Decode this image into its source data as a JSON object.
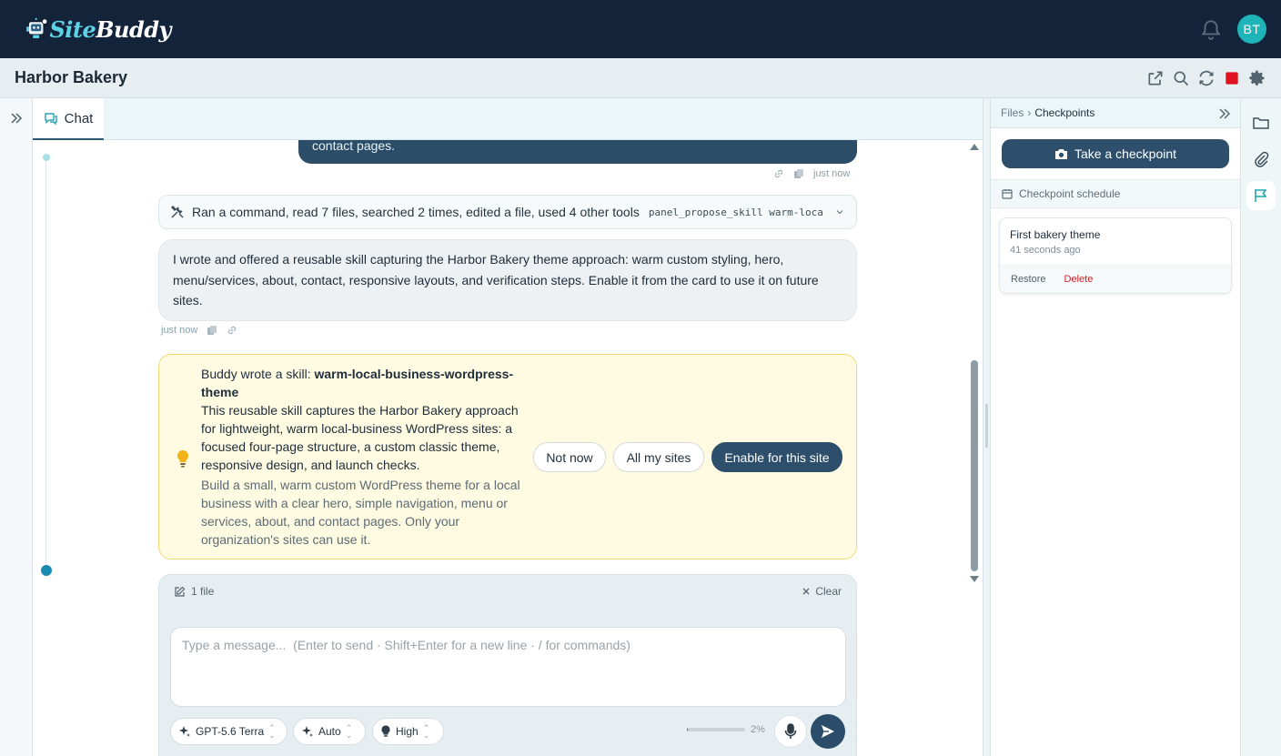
{
  "brand": {
    "logo_site": "Site",
    "logo_buddy": "Buddy"
  },
  "user": {
    "initials": "BT"
  },
  "site": {
    "title": "Harbor Bakery"
  },
  "chat": {
    "tab_label": "Chat",
    "user_message_tail": "contact pages.",
    "user_meta_time": "just now",
    "tools_summary": "Ran a command, read 7 files, searched 2 times, edited a file, used 4 other tools",
    "tools_code": "panel_propose_skill warm-local-business-wordpress-theme",
    "assistant_message": "I wrote and offered a reusable skill capturing the Harbor Bakery theme approach: warm custom styling, hero, menu/services, about, contact, responsive layouts, and verification steps. Enable it from the card to use it on future sites.",
    "assistant_meta_time": "just now"
  },
  "skill": {
    "intro": "Buddy wrote a skill: ",
    "name": "warm-local-business-wordpress-theme",
    "description": "This reusable skill captures the Harbor Bakery approach for lightweight, warm local-business WordPress sites: a focused four-page structure, a custom classic theme, responsive design, and launch checks.",
    "summary": "Build a small, warm custom WordPress theme for a local business with a clear hero, simple navigation, menu or services, about, and contact pages. Only your organization's sites can use it.",
    "btn_not_now": "Not now",
    "btn_all_sites": "All my sites",
    "btn_enable": "Enable for this site"
  },
  "composer": {
    "files_label": "1 file",
    "clear_label": "Clear",
    "placeholder": "Type a message...  (Enter to send · Shift+Enter for a new line · / for commands)",
    "model": "GPT-5.6 Terra",
    "mode": "Auto",
    "effort": "High",
    "context_percent_label": "2%",
    "context_fraction": 0.02
  },
  "panel": {
    "breadcrumb_root": "Files",
    "breadcrumb_sep": "›",
    "breadcrumb_current": "Checkpoints",
    "take_checkpoint": "Take a checkpoint",
    "schedule_label": "Checkpoint schedule",
    "checkpoints": [
      {
        "title": "First bakery theme",
        "time": "41 seconds ago",
        "restore": "Restore",
        "delete": "Delete"
      }
    ]
  },
  "colors": {
    "primary": "#2d4f6b",
    "topbar": "#12233a",
    "accent": "#1fb5b8",
    "stop": "#e0121f",
    "skill_bg": "#fffae2",
    "delete": "#d0202c"
  }
}
